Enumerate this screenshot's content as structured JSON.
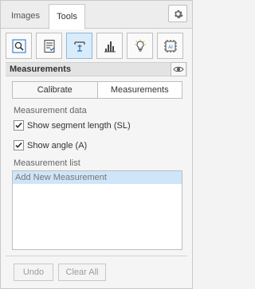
{
  "tabs": {
    "images": "Images",
    "tools": "Tools"
  },
  "toolbar": [
    {
      "icon": "magnifier-icon"
    },
    {
      "icon": "checklist-icon"
    },
    {
      "icon": "measure-icon"
    },
    {
      "icon": "histogram-icon"
    },
    {
      "icon": "lightbulb-icon"
    },
    {
      "icon": "ai-chip-icon"
    }
  ],
  "section": {
    "title": "Measurements"
  },
  "segmented": {
    "calibrate": "Calibrate",
    "measurements": "Measurements"
  },
  "measurement_data": {
    "label": "Measurement data",
    "show_segment_length": "Show segment length (SL)",
    "show_angle": "Show angle (A)"
  },
  "measurement_list": {
    "label": "Measurement list",
    "items": [
      "Add New Measurement"
    ]
  },
  "buttons": {
    "undo": "Undo",
    "clear_all": "Clear All"
  },
  "colors": {
    "accent": "#1a73c9",
    "selection": "#cfe5f9"
  }
}
